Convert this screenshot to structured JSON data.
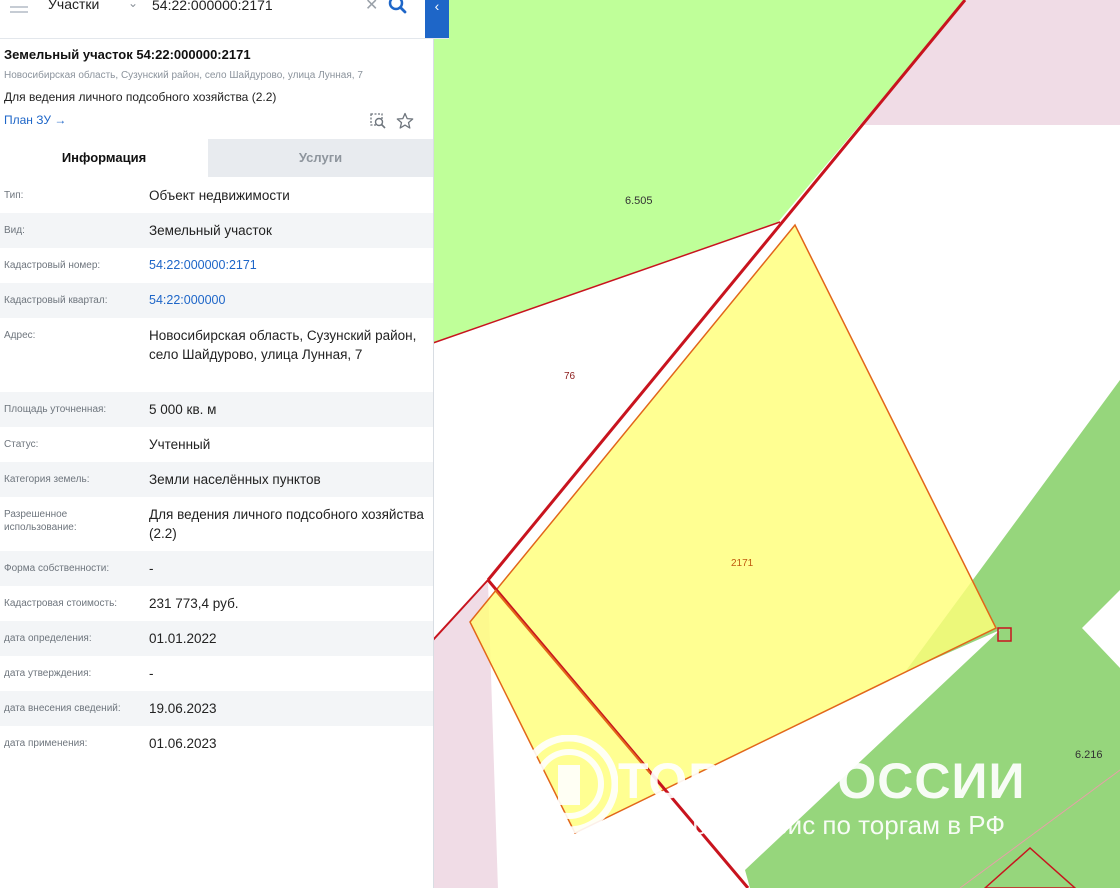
{
  "search": {
    "category": "Участки",
    "query": "54:22:000000:2171"
  },
  "object": {
    "title": "Земельный участок 54:22:000000:2171",
    "address": "Новосибирская область, Сузунский район, село Шайдурово, улица Лунная, 7",
    "use": "Для ведения личного подсобного хозяйства (2.2)",
    "plan_link": "План ЗУ →"
  },
  "tabs": [
    "Информация",
    "Услуги"
  ],
  "info": [
    {
      "label": "Тип:",
      "value": "Объект недвижимости"
    },
    {
      "label": "Вид:",
      "value": "Земельный участок"
    },
    {
      "label": "Кадастровый номер:",
      "value": "54:22:000000:2171"
    },
    {
      "label": "Кадастровый квартал:",
      "value": "54:22:000000"
    },
    {
      "label": "Адрес:",
      "value": "Новосибирская область, Сузунский район, село Шайдурово, улица Лунная, 7"
    },
    {
      "label": "Площадь уточненная:",
      "value": "5 000 кв. м"
    },
    {
      "label": "Статус:",
      "value": "Учтенный"
    },
    {
      "label": "Категория земель:",
      "value": "Земли населённых пунктов"
    },
    {
      "label": "Разрешенное использование:",
      "value": "Для ведения личного подсобного хозяйства (2.2)"
    },
    {
      "label": "Форма собственности:",
      "value": "-"
    },
    {
      "label": "Кадастровая стоимость:",
      "value": "231 773,4 руб."
    },
    {
      "label": "дата определения:",
      "value": "01.01.2022"
    },
    {
      "label": "дата утверждения:",
      "value": "-"
    },
    {
      "label": "дата внесения сведений:",
      "value": "19.06.2023"
    },
    {
      "label": "дата применения:",
      "value": "01.06.2023"
    }
  ],
  "map_labels": {
    "zone_a": "6.505",
    "plot_76": "76",
    "plot_2171": "2171",
    "zone_b": "6.216"
  },
  "watermark": {
    "line1": "ТОРГИ РОССИИ",
    "line2": "маркетплейс по торгам в РФ"
  },
  "colors": {
    "accent": "#1e66c8",
    "boundary": "#c8141e",
    "parcel_fill": "#ffff7a",
    "zone_light_green": "#bfff99",
    "zone_green": "#96d67c",
    "zone_pink": "#f0dce6"
  },
  "icons": [
    "menu-icon",
    "chevron-down-icon",
    "close-icon",
    "search-icon",
    "chevron-left-icon",
    "zoom-to-object-icon",
    "star-icon"
  ]
}
